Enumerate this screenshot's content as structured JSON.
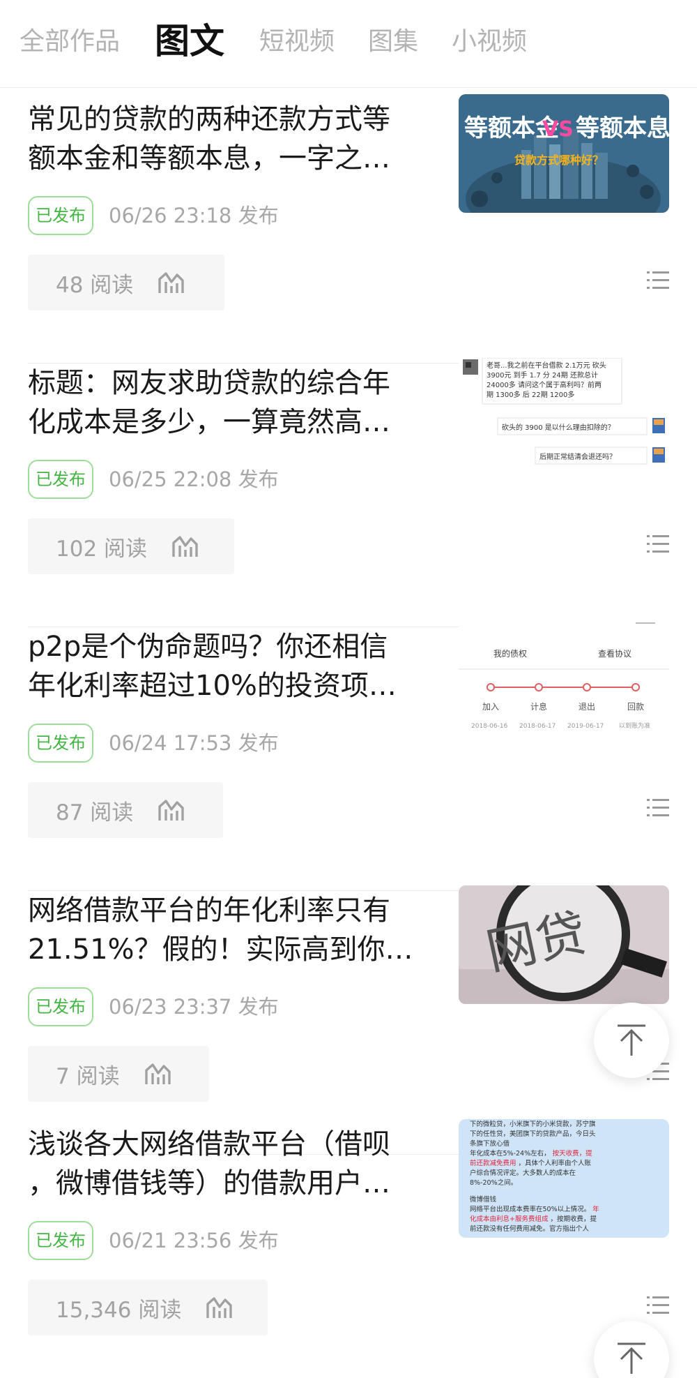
{
  "tabs": [
    {
      "label": "全部作品",
      "active": false
    },
    {
      "label": "图文",
      "active": true
    },
    {
      "label": "短视频",
      "active": false
    },
    {
      "label": "图集",
      "active": false
    },
    {
      "label": "小视频",
      "active": false
    }
  ],
  "articles": [
    {
      "title_line1": "常见的贷款的两种还款方式等",
      "title_line2": "额本金和等额本息，一字之…",
      "status": "已发布",
      "time": "06/26 23:18 发布",
      "reads": "48 阅读",
      "thumb": {
        "big_left": "等额本金",
        "vs": "VS",
        "big_right": "等额本息",
        "sub": "贷款方式哪种好？"
      }
    },
    {
      "title_line1": "标题：网友求助贷款的综合年",
      "title_line2": "化成本是多少，一算竟然高…",
      "status": "已发布",
      "time": "06/25 22:08 发布",
      "reads": "102 阅读",
      "thumb": {
        "msg1_l1": "老哥...我之前在平台借款 2.1万元 砍头",
        "msg1_l2": "3900元 到手 1.7  分 24期 还款总计",
        "msg1_l3": "24000多 请问这个属于高利吗？前两",
        "msg1_l4": "期 1300多 后 22期 1200多",
        "msg2": "砍头的 3900 是以什么理由扣除的？",
        "msg3": "后期正常结清会退还吗？"
      }
    },
    {
      "title_line1": "p2p是个伪命题吗？你还相信",
      "title_line2": "年化利率超过10%的投资项…",
      "status": "已发布",
      "time": "06/24 17:53 发布",
      "reads": "87 阅读",
      "thumb": {
        "tab1": "我的债权",
        "tab2": "查看协议",
        "steps": [
          "加入",
          "计息",
          "退出",
          "回款"
        ],
        "dates": [
          "2018-06-16",
          "2018-06-17",
          "2019-06-17",
          "以到账为准"
        ]
      }
    },
    {
      "title_line1": "网络借款平台的年化利率只有",
      "title_line2": "21.51%？假的！实际高到你…",
      "status": "已发布",
      "time": "06/23 23:37 发布",
      "reads": "7 阅读",
      "thumb": {
        "word": "网贷"
      }
    },
    {
      "title_line1": "浅谈各大网络借款平台（借呗",
      "title_line2": "，微博借钱等）的借款用户…",
      "status": "已发布",
      "time": "06/21 23:56 发布",
      "reads": "15,346 阅读",
      "thumb": {
        "l1": "下的微粒贷，小米旗下的小米贷款，苏宁旗",
        "l2": "下的任性贷，美团旗下的贷款产品，今日头",
        "l3": "条旗下放心借",
        "l4a": "年化成本在5%-24%左右，",
        "l4b": "按天收费，提",
        "l5a": "前还款减免费用",
        "l5b": "，具体个人利率由个人账",
        "l6": "户综合情况评定。大多数人的成本在",
        "l7": "8%-20%之间。",
        "l8": "微博借钱",
        "l9": "网络平台出现成本费率在50%以上情况。",
        "l9b": "年",
        "l10a": "化成本由利息+服务费组成",
        "l10b": "，按期收费，提",
        "l11": "前还款没有任何费用减免。官方指出个人"
      }
    }
  ],
  "colors": {
    "badge_green": "#44b544",
    "muted": "#a7a7a7",
    "stats_bg": "#f6f6f6"
  }
}
